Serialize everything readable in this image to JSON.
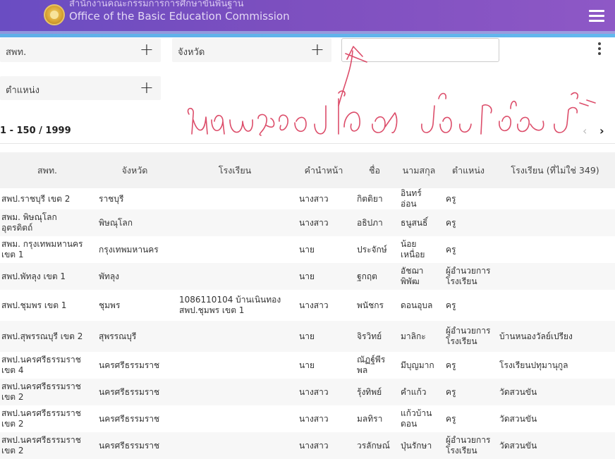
{
  "header": {
    "org_thai": "สำนักงานคณะกรรมการการศึกษาขั้นพื้นฐาน",
    "org_en": "Office of the Basic Education Commission"
  },
  "filters": {
    "district": "สพท.",
    "province": "จังหวัด",
    "position": "ตำแหน่ง",
    "plus": "+"
  },
  "search": {
    "value": "",
    "placeholder": ""
  },
  "annotation": {
    "text": "พิมพ์ชื่อลงไปในช่องได้เลยค่ะ"
  },
  "pagination": {
    "range": "1 - 150 / 1999",
    "prev": "‹",
    "next": "›"
  },
  "table": {
    "headers": [
      "สพท.",
      "จังหวัด",
      "โรงเรียน",
      "คำนำหน้า",
      "ชื่อ",
      "นามสกุล",
      "ตำแหน่ง",
      "โรงเรียน (ที่ไม่ใช่ 349)"
    ],
    "rows": [
      [
        "สพป.ราชบุรี เขต 2",
        "ราชบุรี",
        "",
        "นางสาว",
        "กิตติยา",
        "อินทร์อ่อน",
        "ครู",
        ""
      ],
      [
        "สพม. พิษณุโลก อุตรดิตถ์",
        "พิษณุโลก",
        "",
        "นางสาว",
        "อธิปภา",
        "ธนูสนธิ์",
        "ครู",
        ""
      ],
      [
        "สพม. กรุงเทพมหานคร เขต 1",
        "กรุงเทพมหานคร",
        "",
        "นาย",
        "ประจักษ์",
        "น้อยเหนื่อย",
        "ครู",
        ""
      ],
      [
        "สพป.พัทลุง เขต 1",
        "พัทลุง",
        "",
        "นาย",
        "ฐกฤต",
        "อัชฌาพิพัฒ",
        "ผู้อำนวยการโรงเรียน",
        ""
      ],
      [
        "สพป.ชุมพร เขต 1",
        "ชุมพร",
        "1086110104 บ้านเนินทอง สพป.ชุมพร เขต 1",
        "นางสาว",
        "พนัชกร",
        "ดอนอุบล",
        "ครู",
        ""
      ],
      [
        "สพป.สุพรรณบุรี เขต 2",
        "สุพรรณบุรี",
        "",
        "นาย",
        "จิรวิทย์",
        "มาลิกะ",
        "ผู้อำนวยการโรงเรียน",
        "บ้านหนองวัลย์เปรียง"
      ],
      [
        "สพป.นครศรีธรรมราช เขต 4",
        "นครศรีธรรมราช",
        "",
        "นาย",
        "ณัฏฐ์พีรพล",
        "มีบุญมาก",
        "ครู",
        "โรงเรียนปทุมานุกูล"
      ],
      [
        "สพป.นครศรีธรรมราช เขต 2",
        "นครศรีธรรมราช",
        "",
        "นางสาว",
        "รุ้งทิพย์",
        "คำแก้ว",
        "ครู",
        "วัดสวนขัน"
      ],
      [
        "สพป.นครศรีธรรมราช เขต 2",
        "นครศรีธรรมราช",
        "",
        "นางสาว",
        "มลทิรา",
        "แก้วบ้านดอน",
        "ครู",
        "วัดสวนขัน"
      ],
      [
        "สพป.นครศรีธรรมราช เขต 2",
        "นครศรีธรรมราช",
        "",
        "นางสาว",
        "วรลักษณ์",
        "ปุ่นรักษา",
        "ผู้อำนวยการโรงเรียน",
        "วัดสวนขัน"
      ]
    ]
  }
}
